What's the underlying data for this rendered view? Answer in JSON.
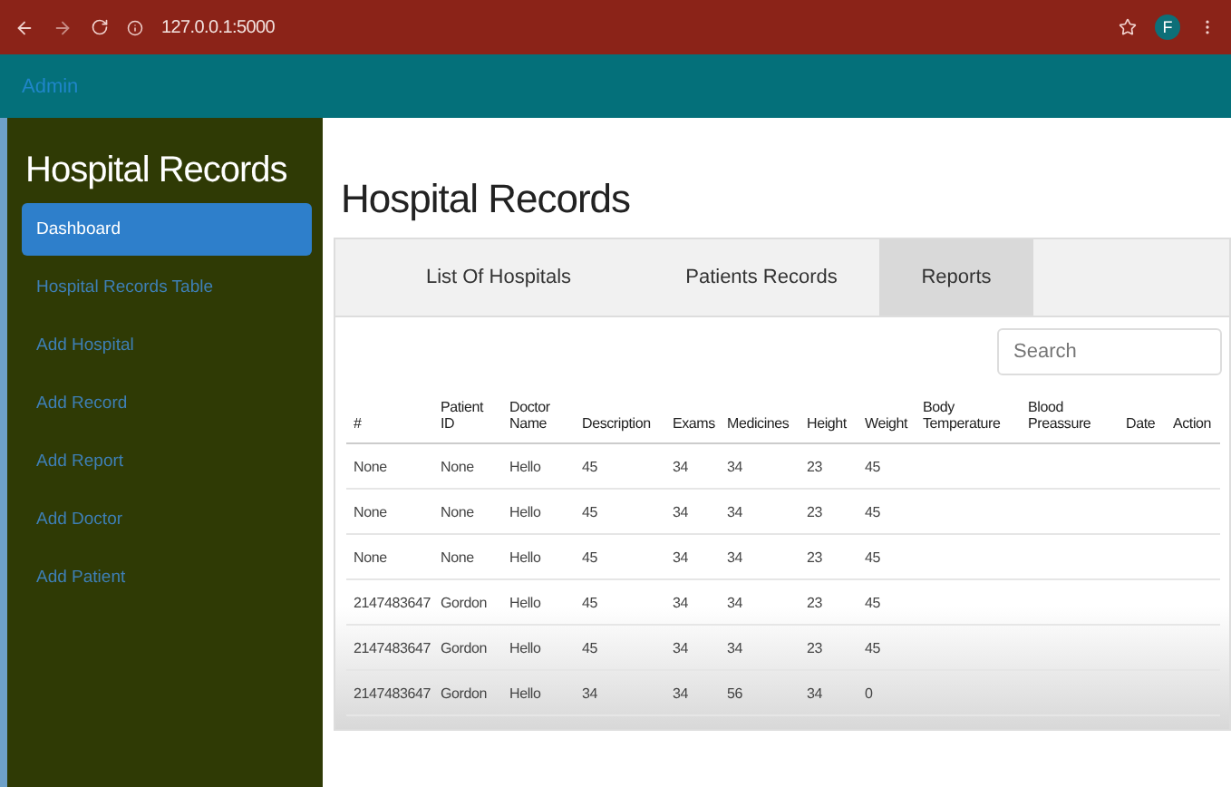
{
  "browser": {
    "url": "127.0.0.1:5000",
    "profile_initial": "F"
  },
  "navbar": {
    "brand": "Admin"
  },
  "sidebar": {
    "title": "Hospital Records",
    "items": [
      {
        "label": "Dashboard",
        "selected": true
      },
      {
        "label": "Hospital Records Table",
        "selected": false
      },
      {
        "label": "Add Hospital",
        "selected": false
      },
      {
        "label": "Add Record",
        "selected": false
      },
      {
        "label": "Add Report",
        "selected": false
      },
      {
        "label": "Add Doctor",
        "selected": false
      },
      {
        "label": "Add Patient",
        "selected": false
      }
    ]
  },
  "page_title": "Hospital Records",
  "tabs": [
    {
      "label": "List Of Hospitals",
      "selected": false
    },
    {
      "label": "Patients Records",
      "selected": false
    },
    {
      "label": "Reports",
      "selected": true
    }
  ],
  "search": {
    "placeholder": "Search"
  },
  "table": {
    "columns": [
      "#",
      "Patient ID",
      "Doctor Name",
      "Description",
      "Exams",
      "Medicines",
      "Height",
      "Weight",
      "Body Temperature",
      "Blood Preassure",
      "Date",
      "Action"
    ],
    "rows": [
      [
        "None",
        "None",
        "Hello",
        "45",
        "34",
        "34",
        "23",
        "45"
      ],
      [
        "None",
        "None",
        "Hello",
        "45",
        "34",
        "34",
        "23",
        "45"
      ],
      [
        "None",
        "None",
        "Hello",
        "45",
        "34",
        "34",
        "23",
        "45"
      ],
      [
        "2147483647",
        "Gordon",
        "Hello",
        "45",
        "34",
        "34",
        "23",
        "45"
      ],
      [
        "2147483647",
        "Gordon",
        "Hello",
        "45",
        "34",
        "34",
        "23",
        "45"
      ],
      [
        "2147483647",
        "Gordon",
        "Hello",
        "34",
        "34",
        "56",
        "34",
        "0"
      ]
    ]
  }
}
